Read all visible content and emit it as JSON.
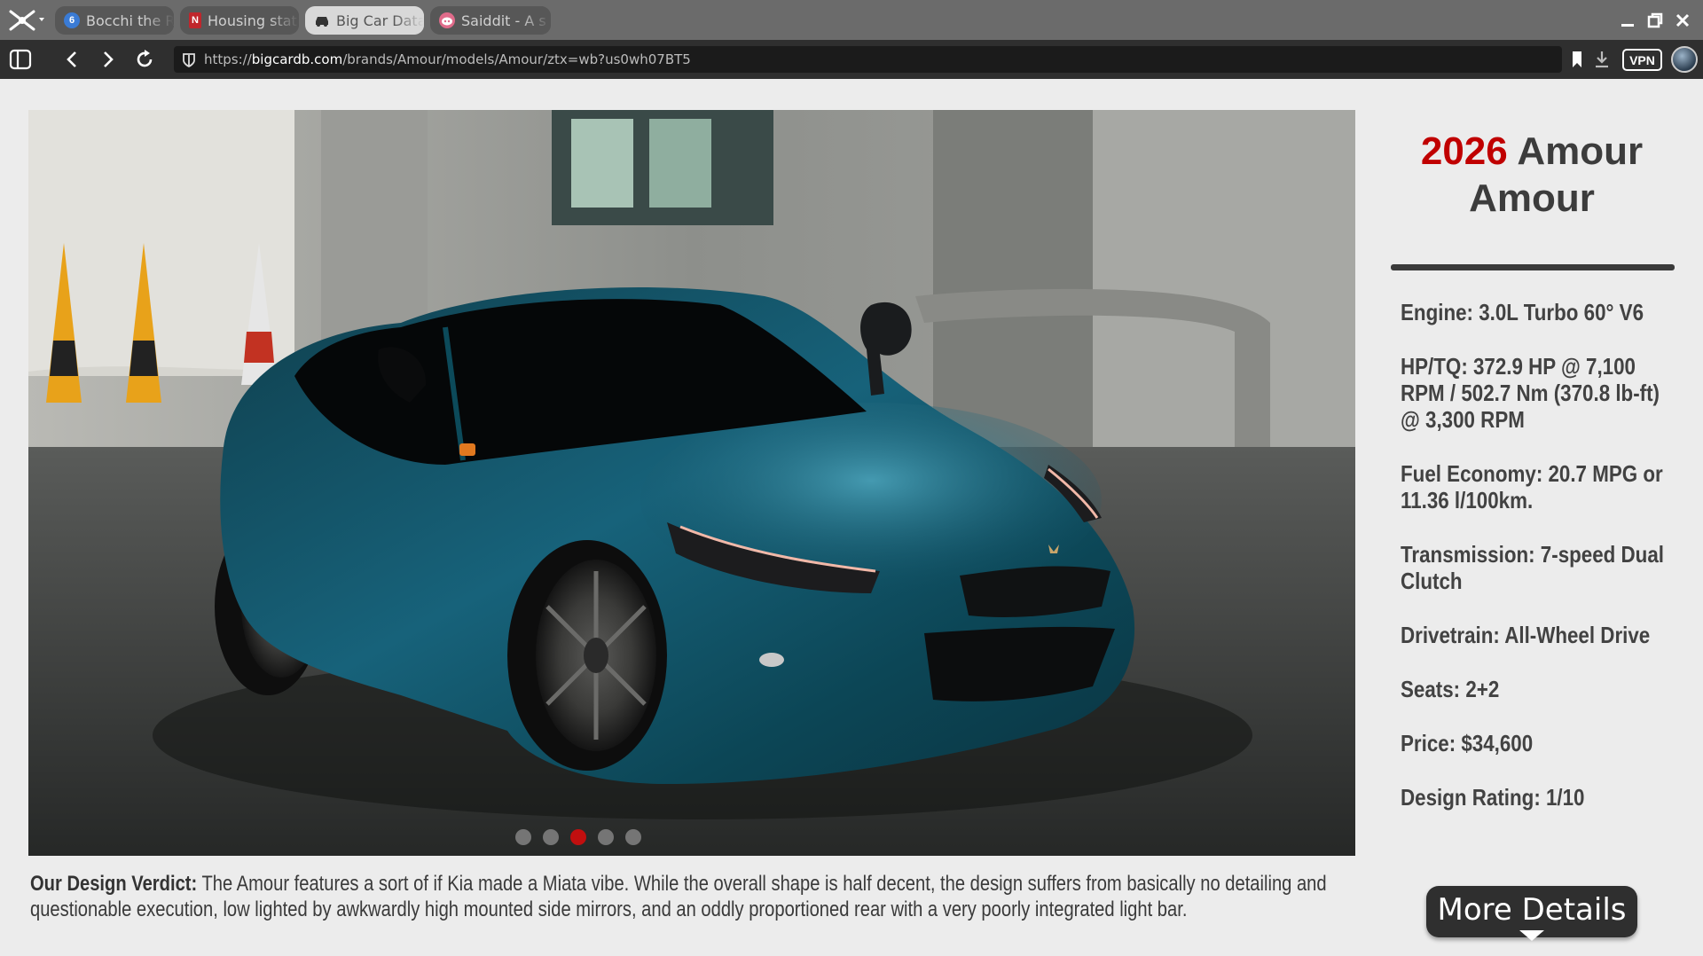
{
  "browser": {
    "tabs": [
      {
        "title": "Bocchi the R",
        "icon": "blue-circle-favicon",
        "active": false
      },
      {
        "title": "Housing stat",
        "icon": "red-n-favicon",
        "active": false
      },
      {
        "title": "Big Car Data",
        "icon": "car-favicon",
        "active": true
      },
      {
        "title": "Saiddit - A s",
        "icon": "saiddit-alien-favicon",
        "active": false
      }
    ],
    "url_prefix": "https://",
    "url_host": "bigcardb.com",
    "url_path": "/brands/Amour/models/Amour/ztx=wb?us0wh07BT5",
    "vpn_label": "VPN"
  },
  "car": {
    "year": "2026",
    "name": "Amour Amour",
    "paint_color": "#0d4a5c"
  },
  "gallery": {
    "image_count": 5,
    "active_index": 2
  },
  "specs": [
    {
      "label": "Engine: 3.0L Turbo 60° V6"
    },
    {
      "label": "HP/TQ: 372.9 HP @ 7,100 RPM / 502.7 Nm (370.8 lb-ft) @ 3,300 RPM"
    },
    {
      "label": "Fuel Economy: 20.7 MPG or 11.36 l/100km."
    },
    {
      "label": "Transmission: 7-speed Dual Clutch"
    },
    {
      "label": "Drivetrain: All-Wheel Drive"
    },
    {
      "label": "Seats: 2+2"
    },
    {
      "label": "Price: $34,600"
    },
    {
      "label": "Design Rating: 1/10"
    }
  ],
  "verdict": {
    "heading": "Our Design Verdict:",
    "text": "The Amour features a sort of if Kia made a Miata vibe. While the overall shape is half decent, the design suffers from basically no detailing and questionable execution, low lighted by awkwardly high mounted side mirrors, and an oddly proportioned rear with a very poorly integrated light bar."
  },
  "more_details_label": "More Details",
  "colors": {
    "accent_red": "#c00000",
    "dot_active": "#d10c0c",
    "dot_inactive": "#7d7d7d"
  }
}
